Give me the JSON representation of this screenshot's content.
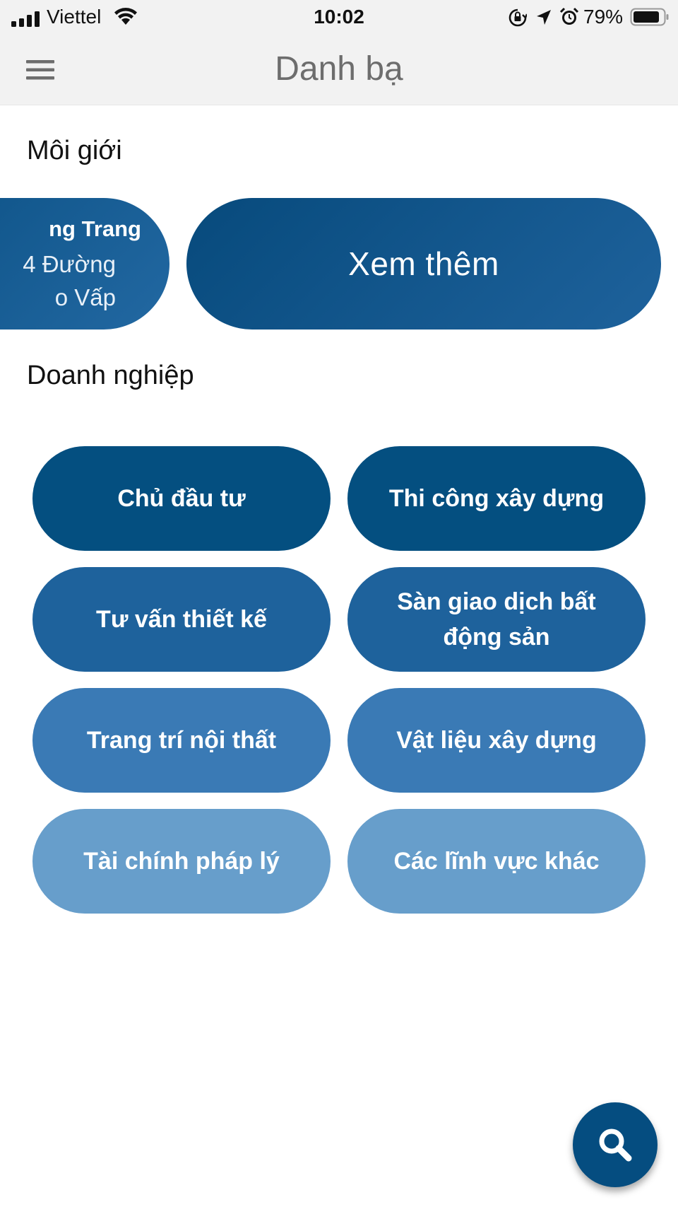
{
  "status_bar": {
    "carrier": "Viettel",
    "time": "10:02",
    "battery_percent": "79%",
    "icons": [
      "signal-icon",
      "wifi-icon",
      "orientation-lock-icon",
      "location-arrow-icon",
      "alarm-icon",
      "battery-icon"
    ]
  },
  "nav": {
    "title": "Danh bạ",
    "menu_icon": "hamburger-menu-icon"
  },
  "sections": {
    "broker": {
      "heading": "Môi giới",
      "card": {
        "name": "ng Trang",
        "address_line1": "4 Đường",
        "address_line2": "o Vấp"
      },
      "see_more_label": "Xem thêm"
    },
    "business": {
      "heading": "Doanh nghiệp",
      "categories": [
        {
          "label": "Chủ đầu tư",
          "color": "#044f80"
        },
        {
          "label": "Thi công xây dựng",
          "color": "#044f80"
        },
        {
          "label": "Tư vấn thiết kế",
          "color": "#1e629c"
        },
        {
          "label": "Sàn giao dịch bất động sản",
          "color": "#1e629c"
        },
        {
          "label": "Trang trí nội thất",
          "color": "#3a7ab5"
        },
        {
          "label": "Vật liệu xây dựng",
          "color": "#3a7ab5"
        },
        {
          "label": "Tài chính pháp lý",
          "color": "#679ecb"
        },
        {
          "label": "Các lĩnh vực khác",
          "color": "#679ecb"
        }
      ]
    }
  },
  "fab": {
    "icon": "search-icon",
    "color": "#054d80"
  }
}
